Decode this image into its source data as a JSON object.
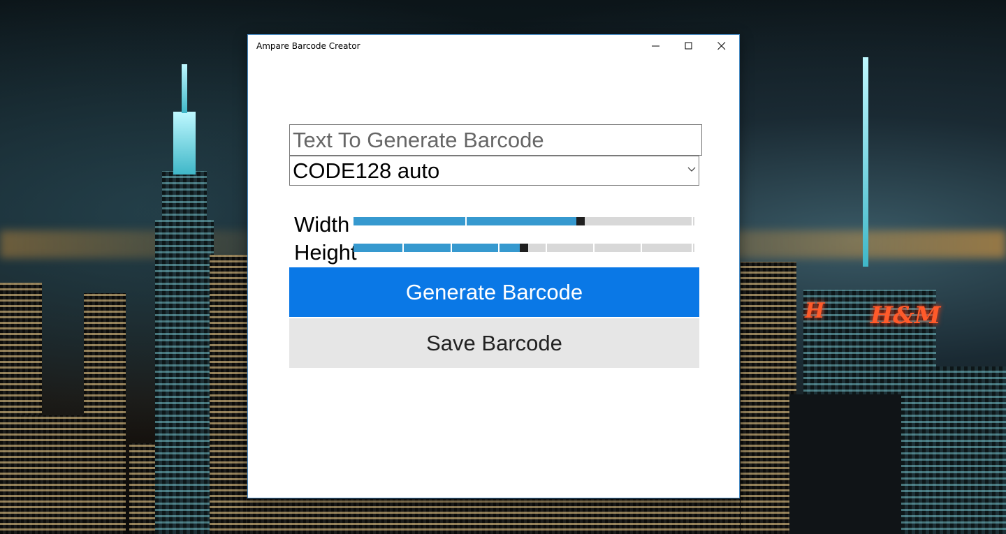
{
  "window": {
    "title": "Ampare Barcode Creator",
    "controls": [
      "minimize-icon",
      "maximize-icon",
      "close-icon"
    ]
  },
  "form": {
    "text_input": {
      "placeholder": "Text To Generate Barcode",
      "value": ""
    },
    "format_select": {
      "value": "CODE128 auto"
    },
    "width": {
      "label": "Width",
      "fraction": 0.67
    },
    "height": {
      "label": "Height",
      "fraction": 0.5
    },
    "generate_label": "Generate Barcode",
    "save_label": "Save Barcode"
  },
  "colors": {
    "accent": "#0a78e6",
    "slider_fill": "#3699cf",
    "secondary_button": "#e6e6e6"
  }
}
